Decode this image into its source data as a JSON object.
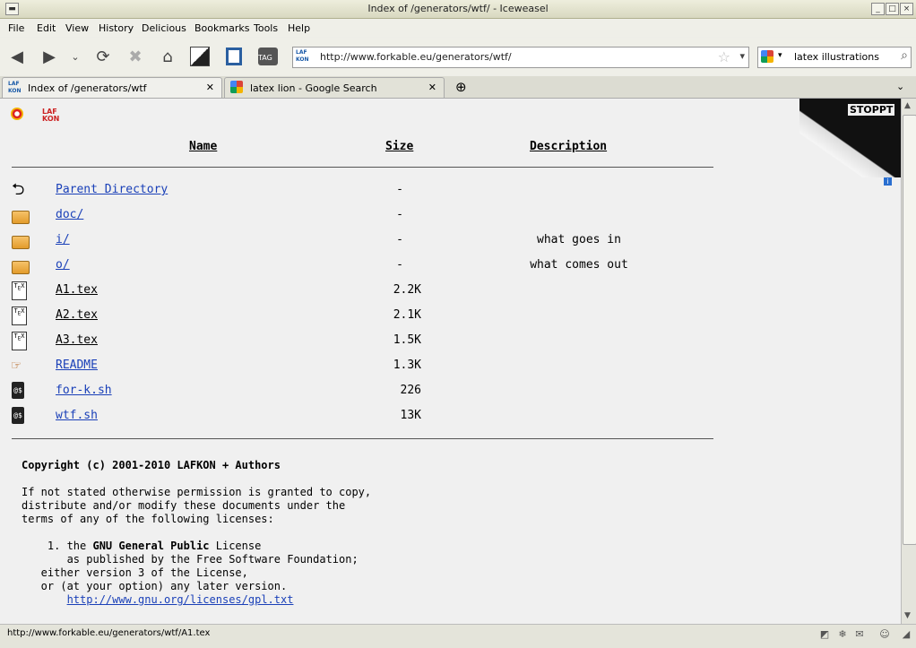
{
  "window": {
    "title": "Index of /generators/wtf/ - Iceweasel"
  },
  "menu": [
    "File",
    "Edit",
    "View",
    "History",
    "Delicious",
    "Bookmarks",
    "Tools",
    "Help"
  ],
  "address": {
    "url": "http://www.forkable.eu/generators/wtf/",
    "site_icon_text": "LAF KON"
  },
  "search": {
    "query": "latex illustrations"
  },
  "tabs": [
    {
      "label": "Index of /generators/wtf",
      "active": true
    },
    {
      "label": "latex lion - Google Search",
      "active": false
    }
  ],
  "page": {
    "logo_text": "LAF KON",
    "headers": {
      "name": "Name",
      "size": "Size",
      "description": "Description"
    },
    "entries": [
      {
        "name": "Parent Directory",
        "size": "-",
        "description": "",
        "icon": "back-arrow-icon",
        "visited": false
      },
      {
        "name": "doc/",
        "size": "-",
        "description": "",
        "icon": "folder-icon",
        "visited": false
      },
      {
        "name": "i/",
        "size": "-",
        "description": "what goes in",
        "icon": "folder-icon",
        "visited": false
      },
      {
        "name": "o/",
        "size": "-",
        "description": "what comes out",
        "icon": "folder-icon",
        "visited": false
      },
      {
        "name": "A1.tex",
        "size": "2.2K",
        "description": "",
        "icon": "tex-file-icon",
        "visited": true
      },
      {
        "name": "A2.tex",
        "size": "2.1K",
        "description": "",
        "icon": "tex-file-icon",
        "visited": true
      },
      {
        "name": "A3.tex",
        "size": "1.5K",
        "description": "",
        "icon": "tex-file-icon",
        "visited": true
      },
      {
        "name": "README",
        "size": "1.3K",
        "description": "",
        "icon": "hand-pointer-icon",
        "visited": false
      },
      {
        "name": "for-k.sh",
        "size": "226",
        "description": "",
        "icon": "script-file-icon",
        "visited": false
      },
      {
        "name": "wtf.sh",
        "size": "13K",
        "description": "",
        "icon": "script-file-icon",
        "visited": false
      }
    ],
    "copyright": "Copyright (c) 2001-2010 LAFKON + Authors",
    "license_intro": "If not stated otherwise permission is granted to copy,\ndistribute and/or modify these documents under the\nterms of any of the following licenses:",
    "license_item_prefix": "1. the ",
    "license_item_bold": "GNU General Public",
    "license_item_suffix": " License",
    "license_item_rest": "   as published by the Free Software Foundation;\n   either version 3 of the License,\n   or (at your option) any later version.",
    "license_link": "http://www.gnu.org/licenses/gpl.txt",
    "ad_text": "STOPPT"
  },
  "status": {
    "text": "http://www.forkable.eu/generators/wtf/A1.tex"
  },
  "colors": {
    "link": "#1a40b8",
    "visited": "#000000",
    "content_bg": "#f0f0f0"
  }
}
